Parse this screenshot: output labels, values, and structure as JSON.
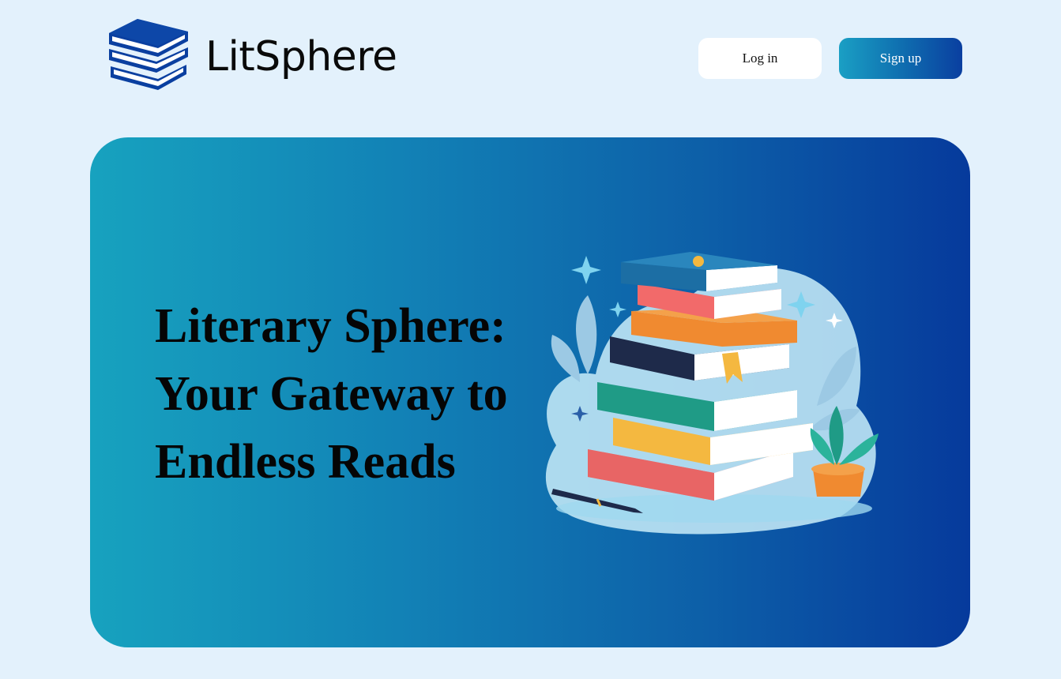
{
  "header": {
    "brand_name": "LitSphere",
    "login_label": "Log in",
    "signup_label": "Sign up"
  },
  "hero": {
    "title_lines": [
      "Literary Sphere:",
      "Your Gateway to",
      "Endless Reads"
    ],
    "illustration": "stack-of-books-illustration"
  },
  "colors": {
    "page_background": "#e3f1fc",
    "brand_blue": "#0a3fa0",
    "hero_gradient_start": "#17a2bf",
    "hero_gradient_end": "#063a9c"
  }
}
